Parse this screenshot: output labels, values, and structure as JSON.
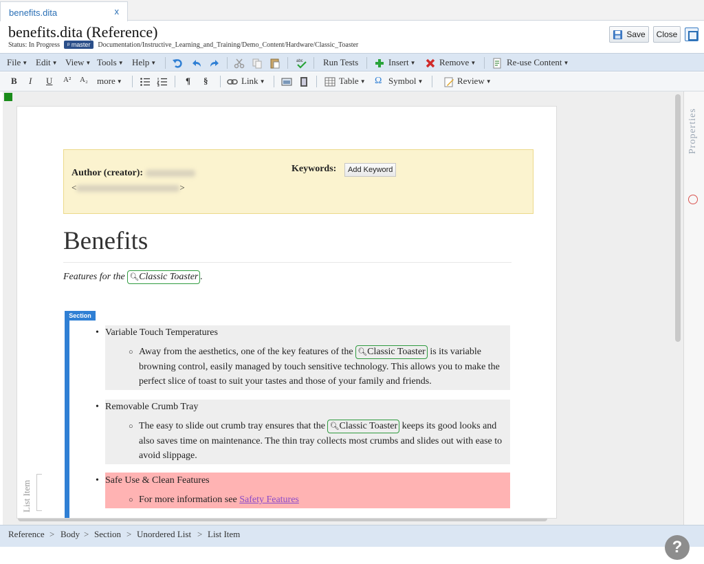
{
  "tab": {
    "label": "benefits.dita",
    "close": "x"
  },
  "header": {
    "title": "benefits.dita (Reference)",
    "status": "Status: In Progress",
    "branch": "master",
    "path": "Documentation/Instructive_Learning_and_Training/Demo_Content/Hardware/Classic_Toaster",
    "save_label": "Save",
    "close_label": "Close"
  },
  "toolbar1": {
    "file": "File",
    "edit": "Edit",
    "view": "View",
    "tools": "Tools",
    "help": "Help",
    "spell": "abc",
    "run_tests": "Run Tests",
    "insert": "Insert",
    "remove": "Remove",
    "reuse": "Re-use Content"
  },
  "toolbar2": {
    "bold": "B",
    "italic": "I",
    "underline": "U",
    "superscript": "A²",
    "subscript": "A₂",
    "more": "more",
    "pilcrow": "¶",
    "section": "§",
    "link": "Link",
    "table": "Table",
    "symbol": "Symbol",
    "omega": "Ω",
    "review": "Review"
  },
  "sidebar": {
    "properties": "Properties"
  },
  "document": {
    "author_label": "Author (creator):",
    "author_email_open": "<",
    "author_email_close": ">",
    "keywords_label": "Keywords:",
    "add_keyword": "Add Keyword",
    "title": "Benefits",
    "shortdesc_prefix": "Features for the ",
    "keyref": "Classic Toaster",
    "shortdesc_suffix": ".",
    "section_tag": "Section",
    "items": [
      {
        "label": "Variable Touch Temperatures",
        "sub_before": "Away from the aesthetics, one of the key features of the ",
        "sub_after": " is its variable browning control, easily managed by touch sensitive technology. This allows you to make the perfect slice of toast to suit your tastes and those of your family and friends."
      },
      {
        "label": "Removable Crumb Tray",
        "sub_before": "The easy to slide out crumb tray ensures that the ",
        "sub_after": " keeps its good looks and also saves time on maintenance. The thin tray collects most crumbs and slides out with ease to avoid slippage."
      },
      {
        "label": "Safe Use & Clean Features",
        "sub_before": "For more information see ",
        "link": "Safety Features"
      }
    ],
    "list_item_label": "List Item"
  },
  "breadcrumb": [
    "Reference",
    "Body",
    "Section",
    "Unordered List",
    "List Item"
  ],
  "help": "?",
  "colors": {
    "accent": "#2f7fd4",
    "toolbar": "#dbe6f3",
    "highlight": "#ffb3b3",
    "keyref_border": "#2e9a3e",
    "meta_bg": "#fbf3cf"
  }
}
